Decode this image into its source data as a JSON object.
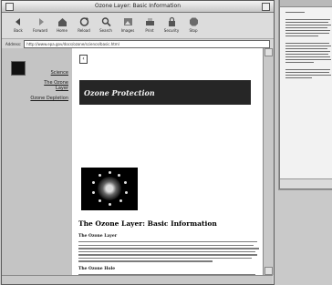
{
  "window": {
    "title": "Ozone Layer: Basic Information",
    "toolbar": {
      "items": [
        {
          "label": "Back",
          "icon": "back-arrow-icon"
        },
        {
          "label": "Forward",
          "icon": "forward-arrow-icon"
        },
        {
          "label": "Home",
          "icon": "home-icon"
        },
        {
          "label": "Reload",
          "icon": "reload-icon"
        },
        {
          "label": "Search",
          "icon": "search-icon"
        },
        {
          "label": "Images",
          "icon": "images-icon"
        },
        {
          "label": "Print",
          "icon": "print-icon"
        },
        {
          "label": "Security",
          "icon": "security-icon"
        },
        {
          "label": "Stop",
          "icon": "stop-icon"
        }
      ]
    },
    "address": {
      "label": "Address:",
      "value": "http://www.epa.gov/docs/ozone/science/basic.html"
    }
  },
  "sidebar": {
    "links": [
      "Science",
      "The Ozone Layer",
      "Ozone Depletion"
    ]
  },
  "page": {
    "back_glyph": "‹",
    "banner": "Ozone Protection",
    "heading": "The Ozone Layer: Basic Information",
    "subheadings": [
      "The Ozone Layer",
      "The Ozone Hole"
    ]
  },
  "colors": {
    "banner_bg": "#262626",
    "sidebar_bg": "#c4c4c4",
    "chrome_bg": "#e4e4e4"
  }
}
